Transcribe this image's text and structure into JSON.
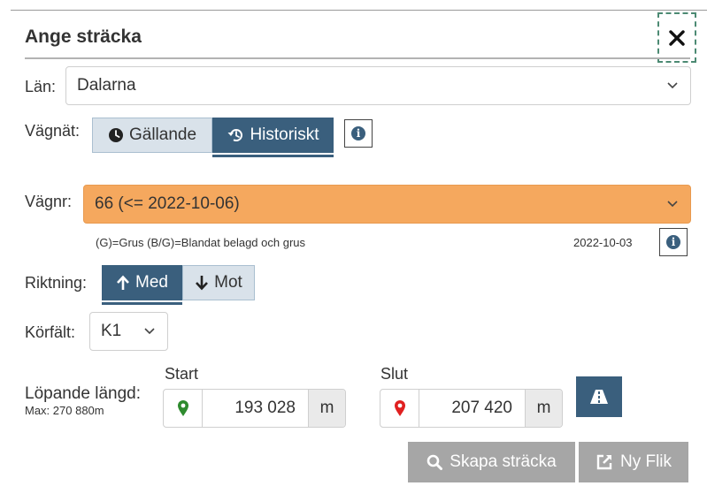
{
  "dialog": {
    "title": "Ange sträcka",
    "close_icon": "close-icon"
  },
  "lan": {
    "label": "Län:",
    "value": "Dalarna"
  },
  "vagnat": {
    "label": "Vägnät:",
    "options": [
      {
        "label": "Gällande",
        "icon": "clock-icon",
        "active": false
      },
      {
        "label": "Historiskt",
        "icon": "history-icon",
        "active": true
      }
    ],
    "info_icon": "info-icon"
  },
  "vagnr": {
    "label": "Vägnr:",
    "value": "66 (<= 2022-10-06)",
    "highlight_color": "#f5a85e",
    "legend": "(G)=Grus (B/G)=Blandat belagd och grus",
    "date": "2022-10-03"
  },
  "riktning": {
    "label": "Riktning:",
    "options": [
      {
        "label": "Med",
        "icon": "arrow-up-icon",
        "active": true
      },
      {
        "label": "Mot",
        "icon": "arrow-down-icon",
        "active": false
      }
    ]
  },
  "korfalt": {
    "label": "Körfält:",
    "value": "K1"
  },
  "lopande": {
    "label": "Löpande längd:",
    "max": "Max: 270 880m",
    "start": {
      "label": "Start",
      "value": "193 028",
      "unit": "m",
      "pin_color": "#2e8b2e"
    },
    "slut": {
      "label": "Slut",
      "value": "207 420",
      "unit": "m",
      "pin_color": "#e02020"
    }
  },
  "actions": {
    "skapa": "Skapa sträcka",
    "ny_flik": "Ny Flik"
  },
  "colors": {
    "accent": "#3a5f7d",
    "button_gray": "#a6a6a6"
  }
}
